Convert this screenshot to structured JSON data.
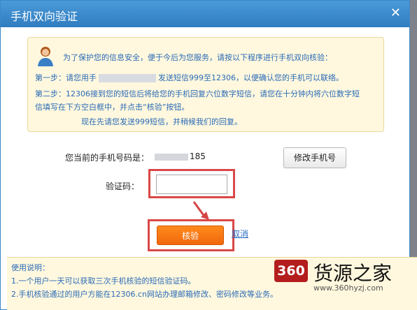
{
  "title": "手机双向验证",
  "notice": {
    "intro": "为了保护您的信息安全，便于今后为您服务，请按以下程序进行手机双向核验：",
    "step1_prefix": "第一步：请您用手",
    "step1_suffix": "发送短信999至12306，以便确认您的手机可以联络。",
    "step2_line1": "第二步：12306接到您的短信后将给您的手机回复六位数字短信，请您在十分钟内将六位数字短",
    "step2_line2": "信填写在下方空白框中，并点击“核验”按钮。",
    "now": "现在先请您发送999短信，并稍候我们的回复。"
  },
  "phone": {
    "label": "您当前的手机号码是：",
    "suffix": "185",
    "change_label": "修改手机号"
  },
  "code": {
    "label": "验证码："
  },
  "verify_label": "核验",
  "cancel_label": "取消",
  "usage": {
    "title": "使用说明：",
    "line1": "1.一个用户一天可以获取三次手机核验的短信验证码。",
    "line2": "2.手机核验通过的用户方能在12306.cn网站办理邮箱修改、密码修改等业务。"
  },
  "watermark": {
    "logo": "360",
    "text": "货源之家",
    "url": "www.360hyzj.com"
  }
}
